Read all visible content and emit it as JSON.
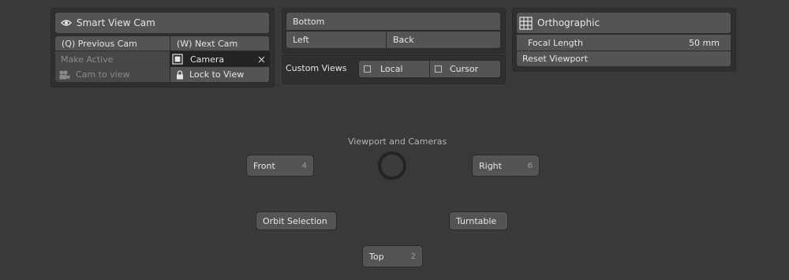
{
  "cameras_panel": {
    "smart_view_cam": "Smart View Cam",
    "previous_cam": "(Q) Previous Cam",
    "next_cam": "(W) Next Cam",
    "make_active": "Make Active",
    "camera_field": "Camera",
    "cam_to_view": "Cam to view",
    "lock_to_view": "Lock to View"
  },
  "views_panel": {
    "bottom": "Bottom",
    "left": "Left",
    "back": "Back",
    "custom_views_label": "Custom Views",
    "local": "Local",
    "cursor": "Cursor"
  },
  "ortho_panel": {
    "orthographic": "Orthographic",
    "focal_length_label": "Focal Length",
    "focal_length_value": "50 mm",
    "reset_viewport": "Reset Viewport"
  },
  "pie_menu": {
    "title": "Viewport and Cameras",
    "front": "Front",
    "front_key": "4",
    "right": "Right",
    "right_key": "6",
    "orbit_selection": "Orbit Selection",
    "turntable": "Turntable",
    "top": "Top",
    "top_key": "2"
  }
}
